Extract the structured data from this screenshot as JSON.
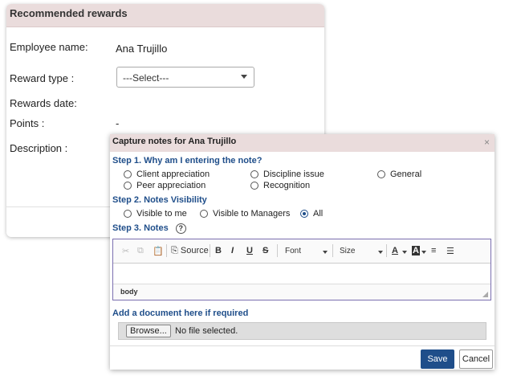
{
  "rewards": {
    "title": "Recommended rewards",
    "employee_label": "Employee name:",
    "employee_value": "Ana Trujillo",
    "reward_type_label": "Reward type :",
    "reward_type_value": "---Select---",
    "rewards_date_label": "Rewards date:",
    "points_label": "Points :",
    "points_value": "-",
    "description_label": "Description :"
  },
  "modal": {
    "title": "Capture notes for Ana Trujillo",
    "close": "×",
    "step1": {
      "label": "Step 1. Why am I entering the note?",
      "options": [
        "Client appreciation",
        "Discipline issue",
        "General",
        "Peer appreciation",
        "Recognition"
      ]
    },
    "step2": {
      "label": "Step 2. Notes Visibility",
      "options": [
        "Visible to me",
        "Visible to Managers",
        "All"
      ],
      "selected": "All"
    },
    "step3": {
      "label": "Step 3. Notes",
      "help": "?"
    },
    "editor": {
      "source_label": "Source",
      "bold": "B",
      "italic": "I",
      "underline": "U",
      "strike": "S",
      "font_label": "Font",
      "size_label": "Size",
      "text_color": "A",
      "bg_color": "A",
      "status_path": "body"
    },
    "document": {
      "label": "Add a document here if required",
      "browse_label": "Browse...",
      "file_status": "No file selected."
    },
    "save_label": "Save",
    "cancel_label": "Cancel"
  },
  "colors": {
    "header_bg": "#eadcdc",
    "accent": "#1f4e8a"
  }
}
